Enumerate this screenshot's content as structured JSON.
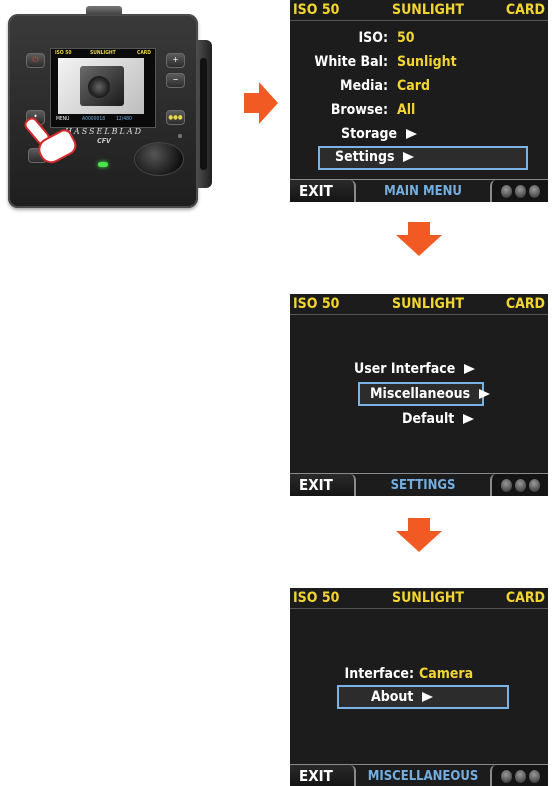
{
  "camera": {
    "lcd_status": {
      "iso": "ISO 50",
      "white_balance": "SUNLIGHT",
      "media": "CARD"
    },
    "lcd_bottom": {
      "menu_label": "MENU",
      "file_id": "A0000018",
      "count": "12/480"
    },
    "brand": "HASSELBLAD",
    "model": "CFV",
    "buttons": {
      "power": "⏻",
      "plus": "+",
      "minus": "−",
      "menu": "•"
    }
  },
  "colors": {
    "status_yellow": "#f2d531",
    "highlight_blue": "#7ab3e6",
    "mode_label_blue": "#74aee0",
    "arrow_orange": "#f15a22"
  },
  "screens": [
    {
      "status": {
        "iso": "ISO 50",
        "white_balance": "SUNLIGHT",
        "media": "CARD"
      },
      "rows": [
        {
          "label": "ISO:",
          "value": "50"
        },
        {
          "label": "White Bal:",
          "value": "Sunlight"
        },
        {
          "label": "Media:",
          "value": "Card"
        },
        {
          "label": "Browse:",
          "value": "All"
        }
      ],
      "submenus": [
        {
          "label": "Storage",
          "selected": false
        },
        {
          "label": "Settings",
          "selected": true
        }
      ],
      "exit_label": "EXIT",
      "mode_label": "MAIN MENU"
    },
    {
      "status": {
        "iso": "ISO 50",
        "white_balance": "SUNLIGHT",
        "media": "CARD"
      },
      "submenus": [
        {
          "label": "User Interface",
          "selected": false
        },
        {
          "label": "Miscellaneous",
          "selected": true
        },
        {
          "label": "Default",
          "selected": false
        }
      ],
      "exit_label": "EXIT",
      "mode_label": "SETTINGS"
    },
    {
      "status": {
        "iso": "ISO 50",
        "white_balance": "SUNLIGHT",
        "media": "CARD"
      },
      "rows": [
        {
          "label": "Interface:",
          "value": "Camera"
        }
      ],
      "submenus": [
        {
          "label": "About",
          "selected": true
        }
      ],
      "exit_label": "EXIT",
      "mode_label": "MISCELLANEOUS"
    }
  ]
}
